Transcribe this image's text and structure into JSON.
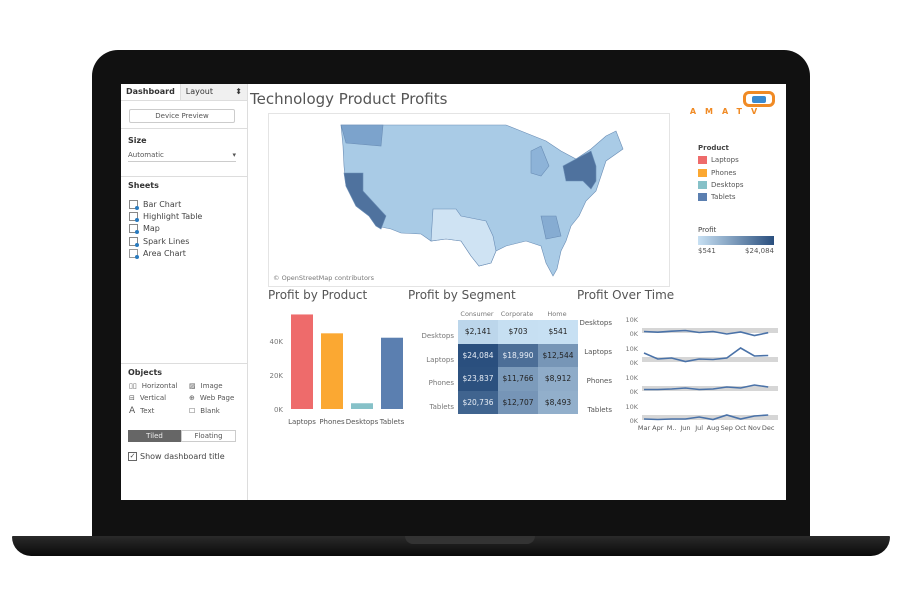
{
  "sidebar": {
    "tabs": [
      "Dashboard",
      "Layout"
    ],
    "device_preview": "Device Preview",
    "size_label": "Size",
    "size_value": "Automatic",
    "sheets_label": "Sheets",
    "sheets": [
      "Bar Chart",
      "Highlight Table",
      "Map",
      "Spark Lines",
      "Area Chart"
    ],
    "objects_label": "Objects",
    "objects": [
      {
        "label": "Horizontal",
        "icon": "horizontal-icon"
      },
      {
        "label": "Image",
        "icon": "image-icon"
      },
      {
        "label": "Vertical",
        "icon": "vertical-icon"
      },
      {
        "label": "Web Page",
        "icon": "globe-icon"
      },
      {
        "label": "Text",
        "icon": "text-icon"
      },
      {
        "label": "Blank",
        "icon": "blank-icon"
      }
    ],
    "tiled": "Tiled",
    "floating": "Floating",
    "show_title": "Show dashboard title",
    "show_title_checked": true
  },
  "dashboard": {
    "title": "Technology Product Profits",
    "logo_text": "AMATV",
    "map_credit": "© OpenStreetMap contributors"
  },
  "legend": {
    "product_title": "Product",
    "products": [
      {
        "name": "Laptops",
        "color": "#ee6b6b"
      },
      {
        "name": "Phones",
        "color": "#fba832"
      },
      {
        "name": "Desktops",
        "color": "#86c1c8"
      },
      {
        "name": "Tablets",
        "color": "#5b7fb0"
      }
    ],
    "profit_title": "Profit",
    "profit_min": "$541",
    "profit_max": "$24,084"
  },
  "chart_data": [
    {
      "type": "bar",
      "title": "Profit by Product",
      "categories": [
        "Laptops",
        "Phones",
        "Desktops",
        "Tablets"
      ],
      "values": [
        55618,
        44515,
        3385,
        41936
      ],
      "colors": [
        "#ee6b6b",
        "#fba832",
        "#86c1c8",
        "#5b7fb0"
      ],
      "yticks": [
        "0K",
        "20K",
        "40K"
      ],
      "ylim": [
        0,
        60000
      ]
    },
    {
      "type": "heatmap",
      "title": "Profit by Segment",
      "columns": [
        "Consumer",
        "Corporate",
        "Home"
      ],
      "rows": [
        "Desktops",
        "Laptops",
        "Phones",
        "Tablets"
      ],
      "values": [
        [
          "$2,141",
          "$703",
          "$541"
        ],
        [
          "$24,084",
          "$18,990",
          "$12,544"
        ],
        [
          "$23,837",
          "$11,766",
          "$8,912"
        ],
        [
          "$20,736",
          "$12,707",
          "$8,493"
        ]
      ],
      "numeric": [
        [
          2141,
          703,
          541
        ],
        [
          24084,
          18990,
          12544
        ],
        [
          23837,
          11766,
          8912
        ],
        [
          20736,
          12707,
          8493
        ]
      ]
    },
    {
      "type": "line",
      "title": "Profit Over Time",
      "x": [
        "Mar",
        "Apr",
        "M..",
        "Jun",
        "Jul",
        "Aug",
        "Sep",
        "Oct",
        "Nov",
        "Dec"
      ],
      "yticks": [
        "10K",
        "0K"
      ],
      "series": [
        {
          "name": "Desktops",
          "values": [
            1.5,
            0.8,
            1.8,
            2.5,
            0.5,
            1.5,
            -1,
            1,
            -2.5,
            0.3
          ]
        },
        {
          "name": "Laptops",
          "values": [
            9,
            3,
            4,
            0.5,
            3,
            2.5,
            4,
            14,
            6,
            6.5
          ]
        },
        {
          "name": "Phones",
          "values": [
            1.5,
            1.5,
            2,
            3,
            1.5,
            2,
            4,
            3,
            6,
            4
          ]
        },
        {
          "name": "Tablets",
          "values": [
            1,
            0.5,
            1,
            1,
            3,
            0.5,
            5,
            1,
            4,
            5
          ]
        }
      ],
      "unit": "K",
      "color": "#4a72a8"
    }
  ]
}
